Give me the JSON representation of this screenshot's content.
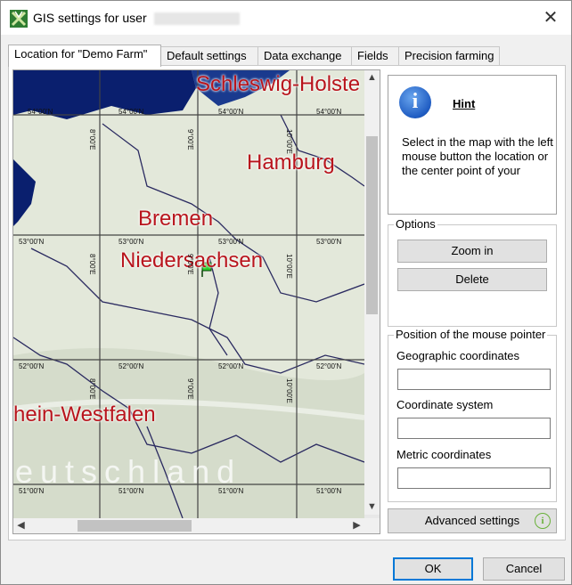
{
  "window": {
    "title": "GIS settings for user",
    "close_glyph": "✕"
  },
  "tabs": [
    {
      "label": "Location for \"Demo Farm\"",
      "active": true
    },
    {
      "label": "Default settings",
      "active": false
    },
    {
      "label": "Data exchange",
      "active": false
    },
    {
      "label": "Fields",
      "active": false
    },
    {
      "label": "Precision farming",
      "active": false
    }
  ],
  "map": {
    "labels": {
      "schleswig": "Schleswig-Holste",
      "hamburg": "Hamburg",
      "bremen": "Bremen",
      "niedersachsen": "Niedersachsen",
      "westfalen": "hein-Westfalen",
      "deutschland": "eutschland"
    },
    "coords": {
      "lat54": "54°00'N",
      "lat53": "53°00'N",
      "lat52": "52°00'N",
      "lat51": "51°00'N",
      "lon8": "8°00'E",
      "lon9": "9°00'E",
      "lon10": "10°00'E"
    },
    "scroll_up": "▲",
    "scroll_down": "▼",
    "scroll_left": "◀",
    "scroll_right": "▶"
  },
  "hint": {
    "title": "Hint",
    "icon": "i",
    "text": "Select in the map with the left mouse button the location or the center point of your"
  },
  "options": {
    "label": "Options",
    "zoom_in": "Zoom in",
    "delete": "Delete"
  },
  "pointer": {
    "label": "Position of the mouse pointer",
    "geographic_label": "Geographic coordinates",
    "geographic_value": "",
    "coord_system_label": "Coordinate system",
    "coord_system_value": "",
    "metric_label": "Metric coordinates",
    "metric_value": ""
  },
  "advanced": {
    "label": "Advanced settings",
    "icon": "i"
  },
  "footer": {
    "ok": "OK",
    "cancel": "Cancel"
  },
  "colors": {
    "sea": "#0a1f6e",
    "land": "#dfe5d6",
    "label_red": "#b8141c",
    "marker": "#22cc22",
    "accent": "#0078d7"
  }
}
